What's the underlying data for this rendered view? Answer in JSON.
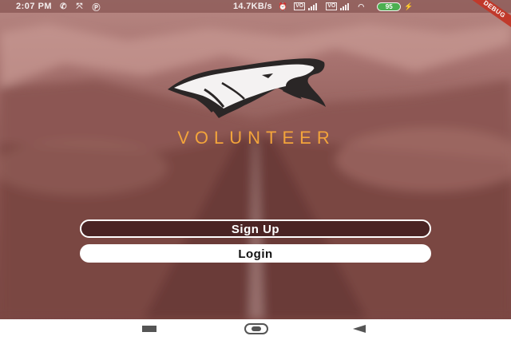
{
  "status_bar": {
    "time": "2:07 PM",
    "network_speed": "14.7KB/s",
    "battery_level": "95",
    "debug_banner": "DEBUG"
  },
  "app": {
    "title": "VOLUNTEER",
    "title_color": "#f3a43b",
    "logo_icon": "wolf-head-logo"
  },
  "buttons": {
    "signup_label": "Sign Up",
    "login_label": "Login"
  },
  "nav_bar": {
    "recent_icon": "recent-apps-icon",
    "home_icon": "home-icon",
    "back_icon": "back-icon"
  }
}
